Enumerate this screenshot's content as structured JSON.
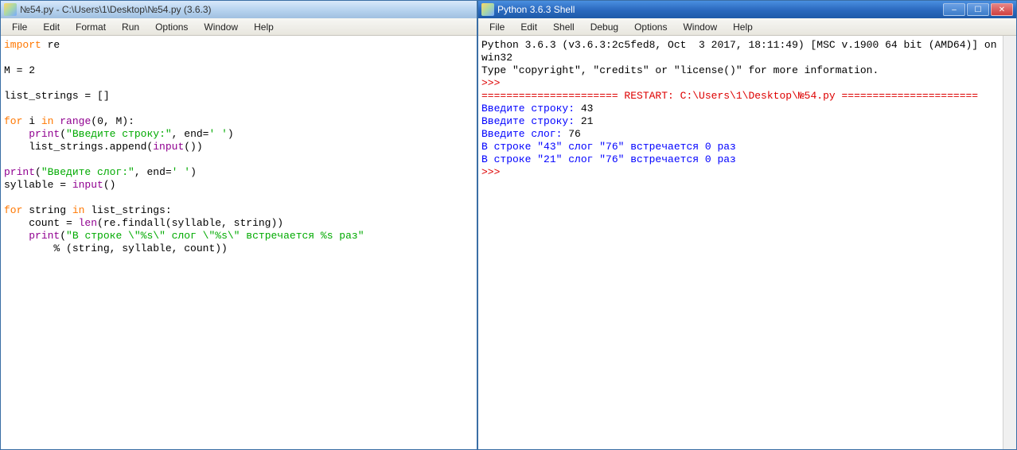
{
  "editor": {
    "title": "№54.py - C:\\Users\\1\\Desktop\\№54.py (3.6.3)",
    "menu": [
      "File",
      "Edit",
      "Format",
      "Run",
      "Options",
      "Window",
      "Help"
    ],
    "code": {
      "lines": [
        [
          {
            "t": "import",
            "c": "orange"
          },
          {
            "t": " re",
            "c": "black"
          }
        ],
        [],
        [
          {
            "t": "M = ",
            "c": "black"
          },
          {
            "t": "2",
            "c": "black"
          }
        ],
        [],
        [
          {
            "t": "list_strings = []",
            "c": "black"
          }
        ],
        [],
        [
          {
            "t": "for",
            "c": "orange"
          },
          {
            "t": " i ",
            "c": "black"
          },
          {
            "t": "in",
            "c": "orange"
          },
          {
            "t": " ",
            "c": "black"
          },
          {
            "t": "range",
            "c": "purple"
          },
          {
            "t": "(",
            "c": "black"
          },
          {
            "t": "0",
            "c": "black"
          },
          {
            "t": ", M):",
            "c": "black"
          }
        ],
        [
          {
            "t": "    ",
            "c": "black"
          },
          {
            "t": "print",
            "c": "purple"
          },
          {
            "t": "(",
            "c": "black"
          },
          {
            "t": "\"Введите строку:\"",
            "c": "green"
          },
          {
            "t": ", end=",
            "c": "black"
          },
          {
            "t": "' '",
            "c": "green"
          },
          {
            "t": ")",
            "c": "black"
          }
        ],
        [
          {
            "t": "    list_strings.append(",
            "c": "black"
          },
          {
            "t": "input",
            "c": "purple"
          },
          {
            "t": "())",
            "c": "black"
          }
        ],
        [],
        [
          {
            "t": "print",
            "c": "purple"
          },
          {
            "t": "(",
            "c": "black"
          },
          {
            "t": "\"Введите слог:\"",
            "c": "green"
          },
          {
            "t": ", end=",
            "c": "black"
          },
          {
            "t": "' '",
            "c": "green"
          },
          {
            "t": ")",
            "c": "black"
          }
        ],
        [
          {
            "t": "syllable = ",
            "c": "black"
          },
          {
            "t": "input",
            "c": "purple"
          },
          {
            "t": "()",
            "c": "black"
          }
        ],
        [],
        [
          {
            "t": "for",
            "c": "orange"
          },
          {
            "t": " string ",
            "c": "black"
          },
          {
            "t": "in",
            "c": "orange"
          },
          {
            "t": " list_strings:",
            "c": "black"
          }
        ],
        [
          {
            "t": "    count = ",
            "c": "black"
          },
          {
            "t": "len",
            "c": "purple"
          },
          {
            "t": "(re.findall(syllable, string))",
            "c": "black"
          }
        ],
        [
          {
            "t": "    ",
            "c": "black"
          },
          {
            "t": "print",
            "c": "purple"
          },
          {
            "t": "(",
            "c": "black"
          },
          {
            "t": "\"В строке \\\"%s\\\" слог \\\"%s\\\" встречается %s раз\"",
            "c": "green"
          }
        ],
        [
          {
            "t": "        % (string, syllable, count))",
            "c": "black"
          }
        ]
      ]
    }
  },
  "shell": {
    "title": "Python 3.6.3 Shell",
    "menu": [
      "File",
      "Edit",
      "Shell",
      "Debug",
      "Options",
      "Window",
      "Help"
    ],
    "controls": {
      "minimize": "–",
      "maximize": "☐",
      "close": "✕"
    },
    "output": {
      "banner1": "Python 3.6.3 (v3.6.3:2c5fed8, Oct  3 2017, 18:11:49) [MSC v.1900 64 bit (AMD64)] on win32",
      "banner2": "Type \"copyright\", \"credits\" or \"license()\" for more information.",
      "prompt": ">>> ",
      "restart": "====================== RESTART: C:\\Users\\1\\Desktop\\№54.py ======================",
      "lines": [
        {
          "prompt": "Введите строку: ",
          "val": "43"
        },
        {
          "prompt": "Введите строку: ",
          "val": "21"
        },
        {
          "prompt": "Введите слог: ",
          "val": "76"
        },
        {
          "text": "В строке \"43\" слог \"76\" встречается 0 раз"
        },
        {
          "text": "В строке \"21\" слог \"76\" встречается 0 раз"
        }
      ]
    }
  }
}
